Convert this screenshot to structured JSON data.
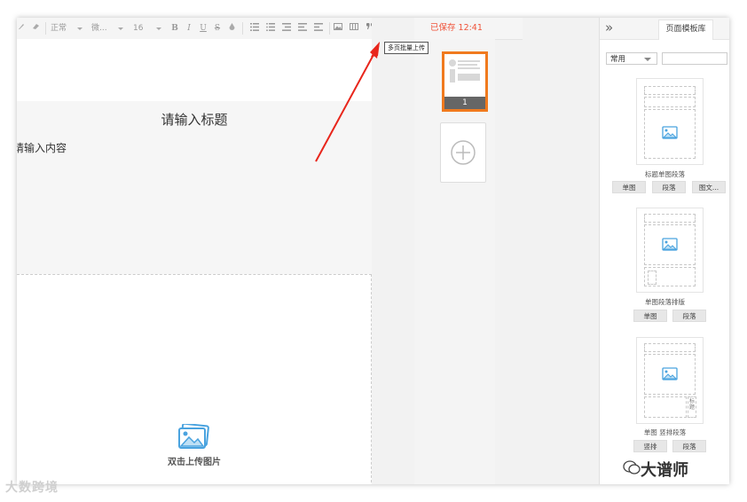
{
  "toolbar": {
    "style_select": "正常",
    "font_select": "微...",
    "size_select": "16",
    "bold": "B",
    "italic": "I",
    "underline": "U",
    "strike": "S",
    "saved_status": "已保存  12:41",
    "tooltip": "多页批量上传"
  },
  "editor": {
    "title_placeholder": "请输入标题",
    "content_placeholder": "请输入内容",
    "image_label": "双击上传图片"
  },
  "pages": {
    "thumb_number": "1"
  },
  "panel": {
    "tab_label": "页面模板库",
    "category_select": "常用",
    "templates": [
      {
        "name": "标题单图段落",
        "buttons": [
          "单图",
          "段落",
          "图文..."
        ]
      },
      {
        "name": "单图段落排版",
        "buttons": [
          "单图",
          "段落"
        ]
      },
      {
        "name": "单图 竖排段落",
        "buttons": [
          "竖排",
          "段落"
        ]
      }
    ],
    "vertical_text": "标题"
  },
  "watermark": {
    "left": "大数跨境",
    "right": "大谱师"
  },
  "colors": {
    "accent_orange": "#f07a1e",
    "saved_red": "#f0533a",
    "arrow_red": "#e8261c",
    "image_icon_blue": "#4aa3df"
  }
}
